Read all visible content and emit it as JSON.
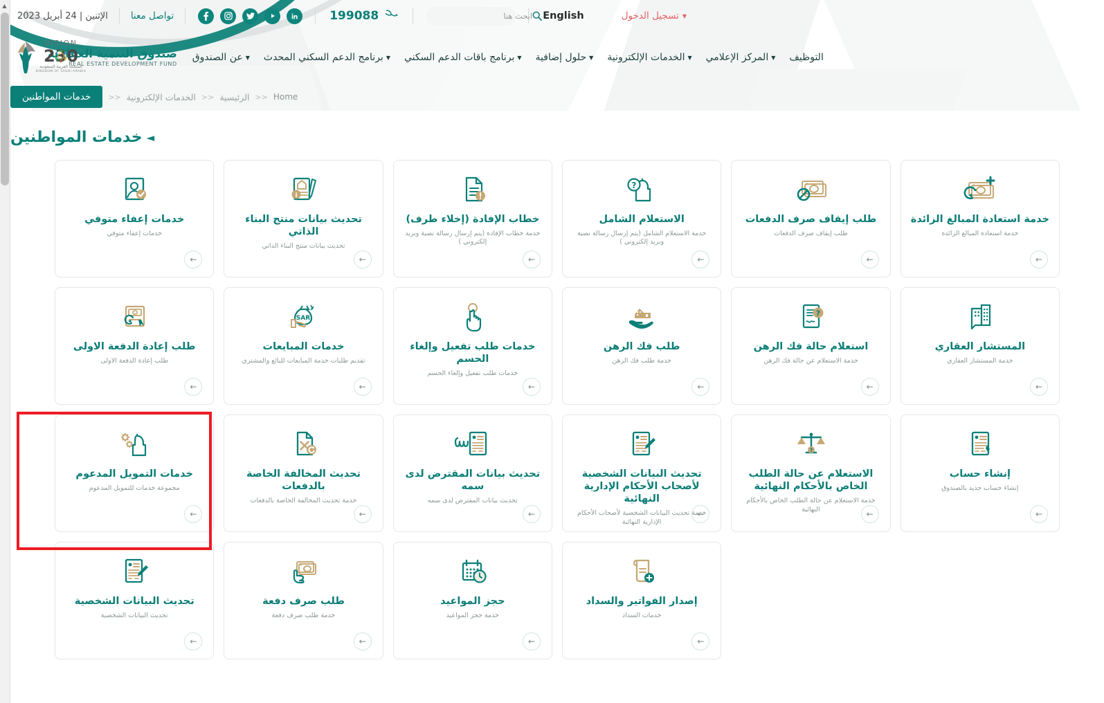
{
  "topbar": {
    "date": "الإثنين | 24 أبريل 2023",
    "contact_label": "تواصل معنا",
    "phone": "199088",
    "phone_icon": "phone-icon",
    "search_placeholder": "ابحث هنا",
    "search_value": "",
    "search_icon": "search-icon",
    "language_label": "English",
    "login_label": "تسجيل الدخول",
    "socials": [
      {
        "name": "facebook-icon",
        "glyph": "f"
      },
      {
        "name": "instagram-icon",
        "glyph": "◙"
      },
      {
        "name": "twitter-icon",
        "glyph": "t"
      },
      {
        "name": "youtube-icon",
        "glyph": "▶"
      },
      {
        "name": "linkedin-icon",
        "glyph": "in"
      }
    ]
  },
  "brand": {
    "arabic": "صندوق التنمية العقارية",
    "english": "REAL ESTATE DEVELOPMENT FUND",
    "logo_icon": "redf-palm-logo"
  },
  "vision": {
    "line1": "VISION رؤية",
    "number": "2030",
    "ar_sub": "المملكة العربية السعودية",
    "en_sub": "KINGDOM OF SAUDI ARABIA"
  },
  "nav": {
    "items": [
      {
        "label": "عن الصندوق",
        "has_caret": true
      },
      {
        "label": "برنامج الدعم السكني المحدث",
        "has_caret": true
      },
      {
        "label": "برنامج باقات الدعم السكني",
        "has_caret": true
      },
      {
        "label": "حلول إضافية",
        "has_caret": true
      },
      {
        "label": "الخدمات الإلكترونية",
        "has_caret": true
      },
      {
        "label": "المركز الإعلامي",
        "has_caret": true
      },
      {
        "label": "التوظيف",
        "has_caret": false
      }
    ]
  },
  "breadcrumb": {
    "active": "خدمات المواطنين",
    "items": [
      {
        "label": "الرئيسية"
      },
      {
        "label": "الخدمات الإلكترونية"
      }
    ],
    "home_en": "Home",
    "separator": "<<"
  },
  "page": {
    "title": "خدمات المواطنين",
    "title_marker": "◄"
  },
  "colors": {
    "brand_teal": "#0b8079",
    "card_title": "#0b7d76",
    "gold": "#c6a875",
    "highlight_red": "#ee1b24",
    "login_red": "#e06161"
  },
  "highlight": {
    "target_card": "إنشاء حساب",
    "color": "#ee1b24"
  },
  "cards": [
    {
      "title": "خدمة استعادة المبالغ الزائدة",
      "desc": "خدمة استعادة المبالغ الزائدة",
      "icon": "banknote-refresh-plus-icon",
      "arrow": "←"
    },
    {
      "title": "طلب إيقاف صرف الدفعات",
      "desc": "طلب إيقاف صرف الدفعات",
      "icon": "banknote-blocked-icon",
      "arrow": "←"
    },
    {
      "title": "الاستعلام الشامل",
      "desc": "خدمة الاستعلام الشامل (يتم إرسال رسالة نصية وبريد إلكتروني )",
      "icon": "person-question-icon",
      "arrow": "←"
    },
    {
      "title": "خطاب الإفادة (إخلاء طرف)",
      "desc": "خدمة خطاب الإفادة (يتم إرسال رسالة نصية وبريد إلكتروني )",
      "icon": "document-alert-icon",
      "arrow": "←"
    },
    {
      "title": "تحديث بيانات منتج البناء الذاتي",
      "desc": "تحديث بيانات منتج البناء الذاتي",
      "icon": "house-document-pen-icon",
      "arrow": "←"
    },
    {
      "title": "خدمات إعفاء متوفي",
      "desc": "خدمات إعفاء متوفي",
      "icon": "id-card-check-icon",
      "arrow": "←"
    },
    {
      "title": "المستشار العقاري",
      "desc": "خدمة المستشار العقاري",
      "icon": "building-chat-icon",
      "arrow": "←"
    },
    {
      "title": "استعلام حالة فك الرهن",
      "desc": "خدمة الاستعلام عن حالة فك الرهن",
      "icon": "document-question-icon",
      "arrow": "←"
    },
    {
      "title": "طلب فك الرهن",
      "desc": "خدمة طلب فك الرهن",
      "icon": "hand-house-icon",
      "arrow": "←"
    },
    {
      "title": "خدمات طلب تفعيل وإلغاء الحسم",
      "desc": "خدمات طلب تفعيل وإلغاء الحسم",
      "icon": "hand-click-icon",
      "arrow": "←"
    },
    {
      "title": "خدمات المبايعات",
      "desc": "تقديم طلبات خدمة المبايعات للبائع والمشتري",
      "icon": "money-bag-sar-icon",
      "arrow": "←"
    },
    {
      "title": "طلب إعادة الدفعة الاولى",
      "desc": "طلب إعادة الدفعة الاولى",
      "icon": "banknote-cursor-icon",
      "arrow": "←"
    },
    {
      "title": "إنشاء حساب",
      "desc": "إنشاء حساب جديد بالصندوق",
      "icon": "create-account-document-icon",
      "arrow": "←",
      "highlighted": true
    },
    {
      "title": "الاستعلام عن حالة الطلب الخاص بالأحكام النهائية",
      "desc": "خدمة الاستعلام عن حالة الطلب الخاص بالأحكام النهائية",
      "icon": "scales-justice-icon",
      "arrow": "←"
    },
    {
      "title": "تحديث البيانات الشخصية لأصحاب الأحكام الإدارية النهائية",
      "desc": "خدمة تحديث البيانات الشخصية لأصحاب الأحكام الإدارية النهائية",
      "icon": "document-edit-icon",
      "arrow": "←"
    },
    {
      "title": "تحديث بيانات المقترض لدى سمه",
      "desc": "تحديث بيانات المقترض لدى سمه",
      "icon": "simah-document-icon",
      "arrow": "←"
    },
    {
      "title": "تحديث المخالفة الخاصة بالدفعات",
      "desc": "خدمة تحديث المخالفة الخاصة بالدفعات",
      "icon": "document-x-refresh-icon",
      "arrow": "←"
    },
    {
      "title": "خدمات التمويل المدعوم",
      "desc": "مجموعة خدمات للتمويل المدعوم",
      "icon": "person-gears-icon",
      "arrow": "←"
    },
    {
      "title": "",
      "desc": "",
      "icon": "",
      "arrow": "",
      "empty": true
    },
    {
      "title": "",
      "desc": "",
      "icon": "",
      "arrow": "",
      "empty": true
    },
    {
      "title": "إصدار الفواتير والسداد",
      "desc": "خدمات السداد",
      "icon": "invoice-scroll-plus-icon",
      "arrow": "←"
    },
    {
      "title": "حجز المواعيد",
      "desc": "خدمة حجز المواعيد",
      "icon": "calendar-clock-icon",
      "arrow": "←"
    },
    {
      "title": "طلب صرف دفعة",
      "desc": "خدمة طلب صرف دفعة",
      "icon": "hand-banknotes-icon",
      "arrow": "←"
    },
    {
      "title": "تحديث البيانات الشخصية",
      "desc": "تحديث البيانات الشخصية",
      "icon": "document-edit-icon",
      "arrow": "←"
    }
  ]
}
